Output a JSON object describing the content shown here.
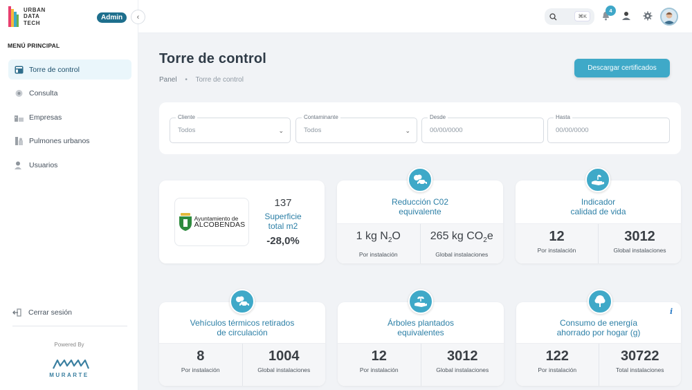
{
  "sidebar": {
    "logo_lines": [
      "URBAN",
      "DATA",
      "TECH"
    ],
    "admin_badge": "Admin",
    "menu_title": "MENÚ PRINCIPAL",
    "items": [
      {
        "label": "Torre de control",
        "icon": "dashboard-icon",
        "active": true
      },
      {
        "label": "Consulta",
        "icon": "query-icon",
        "active": false
      },
      {
        "label": "Empresas",
        "icon": "companies-icon",
        "active": false
      },
      {
        "label": "Pulmones urbanos",
        "icon": "urban-lungs-icon",
        "active": false
      },
      {
        "label": "Usuarios",
        "icon": "users-icon",
        "active": false
      }
    ],
    "logout": "Cerrar sesión",
    "powered_by": "Powered By",
    "brand": "MURARTE"
  },
  "header": {
    "search_shortcut": "⌘K",
    "notifications_count": "4"
  },
  "page": {
    "title": "Torre de control",
    "breadcrumb": [
      "Panel",
      "Torre de control"
    ],
    "download_button": "Descargar certificados"
  },
  "filters": {
    "cliente": {
      "label": "Cliente",
      "value": "Todos"
    },
    "contaminante": {
      "label": "Contaminante",
      "value": "Todos"
    },
    "desde": {
      "label": "Desde",
      "placeholder": "00/00/0000"
    },
    "hasta": {
      "label": "Hasta",
      "placeholder": "00/00/0000"
    }
  },
  "summary": {
    "org_line1": "Ayuntamiento de",
    "org_line2": "ALCOBENDAS",
    "value": "137",
    "label_line1": "Superficie",
    "label_line2": "total m2",
    "change": "-28,0%"
  },
  "cards": {
    "co2": {
      "title_line1": "Reducción C02",
      "title_line2": "equivalente",
      "left_value_main": "1 kg N",
      "left_value_sub": "2",
      "left_value_end": "O",
      "left_label": "Por instalación",
      "right_value_main": "265 kg CO",
      "right_value_sub": "2",
      "right_value_end": "e",
      "right_label": "Global instalaciones"
    },
    "quality": {
      "title_line1": "Indicador",
      "title_line2": "calidad de vida",
      "left_value": "12",
      "left_label": "Por instalación",
      "right_value": "3012",
      "right_label": "Global instalaciones"
    },
    "vehicles": {
      "title_line1": "Vehículos térmicos retirados",
      "title_line2": "de circulación",
      "left_value": "8",
      "left_label": "Por instalación",
      "right_value": "1004",
      "right_label": "Global instalaciones"
    },
    "trees": {
      "title_line1": "Árboles plantados",
      "title_line2": "equivalentes",
      "left_value": "12",
      "left_label": "Por instalación",
      "right_value": "3012",
      "right_label": "Global instalaciones"
    },
    "energy": {
      "title_line1": "Consumo de energía",
      "title_line2": "ahorrado por hogar (g)",
      "info": "i",
      "left_value": "122",
      "left_label": "Por instalación",
      "right_value": "30722",
      "right_label": "Total instalaciones"
    }
  },
  "colors": {
    "accent": "#3fa9c8",
    "title_blue": "#2c7fa6",
    "admin_badge": "#1e6f8d"
  }
}
